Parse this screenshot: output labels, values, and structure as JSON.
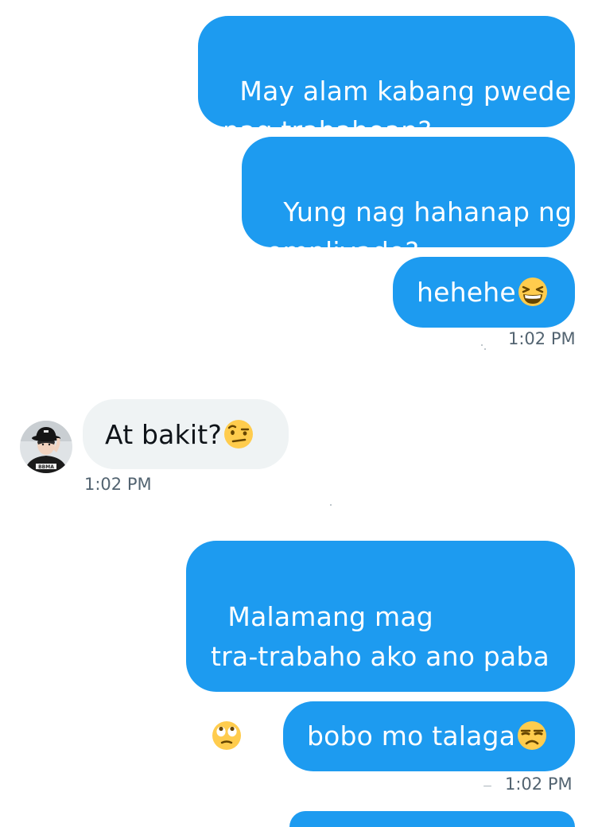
{
  "messages": [
    {
      "text": "May alam kabang pwede\npag trabahoan?",
      "direction": "sent"
    },
    {
      "text": "Yung nag hahanap ng\nempliyado?",
      "direction": "sent"
    },
    {
      "text": "hehehe",
      "direction": "sent",
      "emoji": "grinning-squinting-face"
    },
    {
      "text": "At bakit?",
      "direction": "received",
      "emoji": "face-with-raised-eyebrow"
    },
    {
      "text": "Malamang mag\ntra-trabaho ako ano paba",
      "direction": "sent",
      "emoji": "face-with-rolling-eyes"
    },
    {
      "text": "bobo mo talaga",
      "direction": "sent",
      "emoji": "unamused-face"
    }
  ],
  "timestamps": {
    "group1": "1:02 PM",
    "received": "1:02 PM",
    "group2": "1:02 PM"
  },
  "avatar": {
    "icon": "profile-photo-person-in-bucket-hat",
    "shirt_text": "BBMA"
  },
  "colors": {
    "sent_bubble": "#1d9bf0",
    "received_bubble": "#eff3f4",
    "timestamp": "#536471",
    "emoji_yellow": "#ffcc4d"
  }
}
